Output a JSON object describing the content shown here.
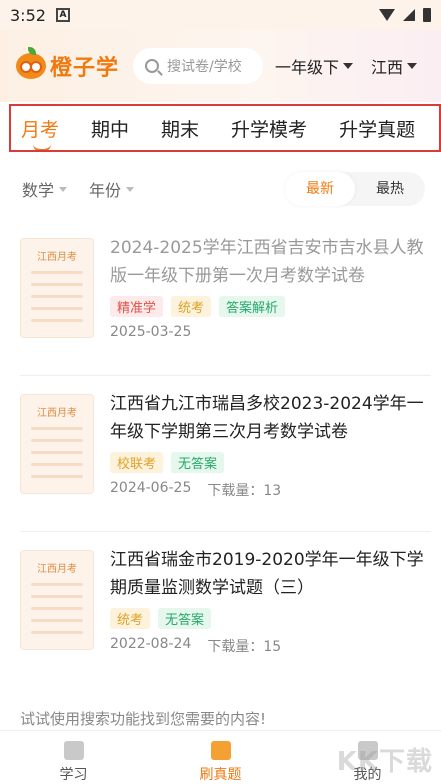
{
  "status": {
    "time": "3:52",
    "sim_badge": "A"
  },
  "header": {
    "logo_text": "橙子学",
    "search_placeholder": "搜试卷/学校",
    "grade": "一年级下",
    "region": "江西"
  },
  "tabs": [
    {
      "label": "月考",
      "active": true
    },
    {
      "label": "期中",
      "active": false
    },
    {
      "label": "期末",
      "active": false
    },
    {
      "label": "升学模考",
      "active": false
    },
    {
      "label": "升学真题",
      "active": false
    }
  ],
  "filters": {
    "subject": "数学",
    "year": "年份",
    "sort_latest": "最新",
    "sort_hottest": "最热"
  },
  "cards": [
    {
      "thumb_label": "江西月考",
      "title": "2024-2025学年江西省吉安市吉水县人教版一年级下册第一次月考数学试卷",
      "tags": [
        "精准学",
        "统考",
        "答案解析"
      ],
      "date": "2025-03-25",
      "downloads": ""
    },
    {
      "thumb_label": "江西月考",
      "title": "江西省九江市瑞昌多校2023-2024学年一年级下学期第三次月考数学试卷",
      "tags": [
        "校联考",
        "无答案"
      ],
      "date": "2024-06-25",
      "downloads": "下载量：13"
    },
    {
      "thumb_label": "江西月考",
      "title": "江西省瑞金市2019-2020学年一年级下学期质量监测数学试题（三）",
      "tags": [
        "统考",
        "无答案"
      ],
      "date": "2022-08-24",
      "downloads": "下载量：15"
    }
  ],
  "hint": "试试使用搜索功能找到您需要的内容!",
  "bottom_nav": [
    {
      "label": "学习",
      "icon": "book-icon",
      "active": false
    },
    {
      "label": "刷真题",
      "icon": "papers-icon",
      "active": true
    },
    {
      "label": "我的",
      "icon": "profile-icon",
      "active": false
    }
  ],
  "watermark": "KK下载",
  "colors": {
    "accent": "#f07a12",
    "highlight_border": "#d93a3a"
  }
}
